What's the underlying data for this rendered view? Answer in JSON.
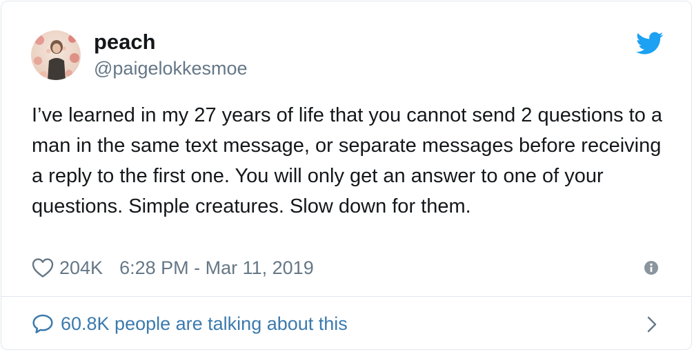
{
  "user": {
    "name": "peach",
    "handle": "@paigelokkesmoe"
  },
  "tweet": {
    "text": "I’ve learned in my 27 years of life that you cannot send 2 questions to a man in the same text message, or separate messages before receiving a reply to the first one. You will only get an answer to one of your questions. Simple creatures. Slow down for them.",
    "like_count": "204K",
    "timestamp": "6:28 PM - Mar 11, 2019"
  },
  "footer": {
    "talking_label": "60.8K people are talking about this"
  },
  "icons": {
    "brand": "twitter-bird-icon",
    "like": "heart-icon",
    "info": "info-icon",
    "conversation": "speech-bubble-icon",
    "navigate": "chevron-right-icon"
  },
  "colors": {
    "twitter_blue": "#1da1f2",
    "link_blue": "#3b7aad",
    "secondary_text": "#657786",
    "primary_text": "#14171a",
    "border": "#e1e8ed"
  }
}
